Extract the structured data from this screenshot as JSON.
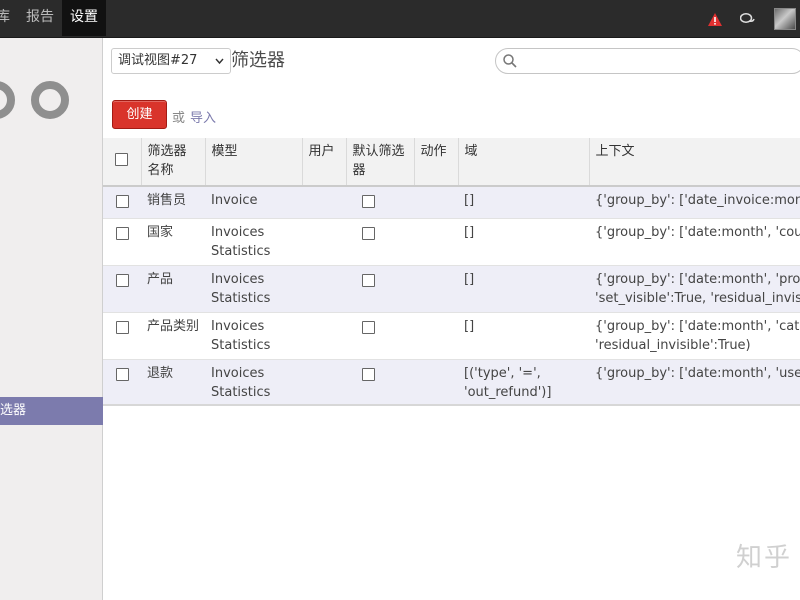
{
  "topbar": {
    "menu": [
      "库",
      "报告",
      "设置"
    ],
    "active_index": 2
  },
  "sidebar": {
    "active_item": "选器"
  },
  "control_panel": {
    "view_select": "调试视图#27",
    "title": "筛选器",
    "create_label": "创建",
    "or_label": "或",
    "import_label": "导入",
    "search_placeholder": ""
  },
  "table": {
    "headers": [
      "筛选器名称",
      "模型",
      "用户",
      "默认筛选器",
      "动作",
      "域",
      "上下文"
    ],
    "rows": [
      {
        "name": "销售员",
        "model": "Invoice",
        "model2": "",
        "user": "",
        "action": "",
        "domain": "[]",
        "domain2": "",
        "context": "{'group_by': ['date_invoice:month'",
        "context2": ""
      },
      {
        "name": "国家",
        "model": "Invoices",
        "model2": "Statistics",
        "user": "",
        "action": "",
        "domain": "[]",
        "domain2": "",
        "context": "{'group_by': ['date:month', 'country",
        "context2": ""
      },
      {
        "name": "产品",
        "model": "Invoices",
        "model2": "Statistics",
        "user": "",
        "action": "",
        "domain": "[]",
        "domain2": "",
        "context": "{'group_by': ['date:month', 'produc",
        "context2": "'set_visible':True, 'residual_invisib"
      },
      {
        "name": "产品类别",
        "model": "Invoices",
        "model2": "Statistics",
        "user": "",
        "action": "",
        "domain": "[]",
        "domain2": "",
        "context": "{'group_by': ['date:month', 'categ_",
        "context2": "'residual_invisible':True)"
      },
      {
        "name": "退款",
        "model": "Invoices",
        "model2": "Statistics",
        "user": "",
        "action": "",
        "domain": "[('type', '=',",
        "domain2": "'out_refund')]",
        "context": "{'group_by': ['date:month', 'user_id",
        "context2": ""
      }
    ]
  },
  "watermark": "知乎",
  "colors": {
    "navbar": "#2b2b2b",
    "accent": "#7c7bad",
    "create_button": "#d9342b",
    "alert": "#e03030"
  },
  "icons": [
    "alert-triangle-icon",
    "chat-bubbles-icon",
    "user-avatar",
    "search-icon",
    "dropdown-caret-icon",
    "odoo-logo"
  ]
}
